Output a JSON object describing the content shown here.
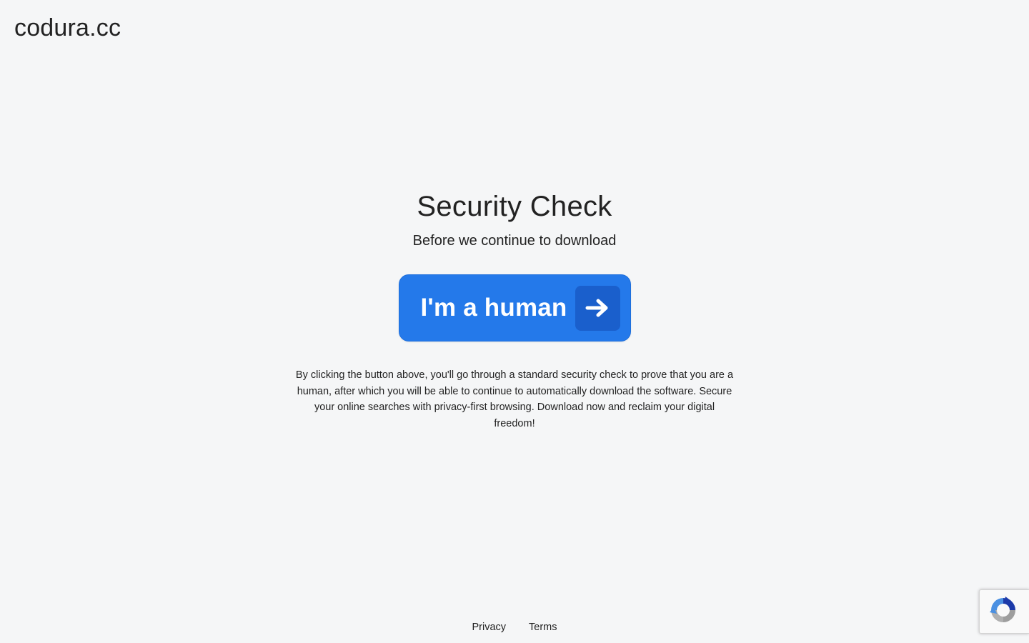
{
  "header": {
    "site_name": "codura.cc"
  },
  "main": {
    "title": "Security Check",
    "subtitle": "Before we continue to download",
    "button_label": "I'm a human",
    "description": "By clicking the button above, you'll go through a standard security check to prove that you are a human, after which you will be able to continue to automatically download the software. Secure your online searches with privacy-first browsing. Download now and reclaim your digital freedom!"
  },
  "footer": {
    "links": [
      "Privacy",
      "Terms"
    ]
  },
  "colors": {
    "background": "#f5f6f7",
    "button": "#2479ea",
    "button_icon_box": "#1a5fcc"
  },
  "icons": {
    "button_icon": "arrow-right-icon",
    "badge_icon": "recaptcha-icon"
  }
}
